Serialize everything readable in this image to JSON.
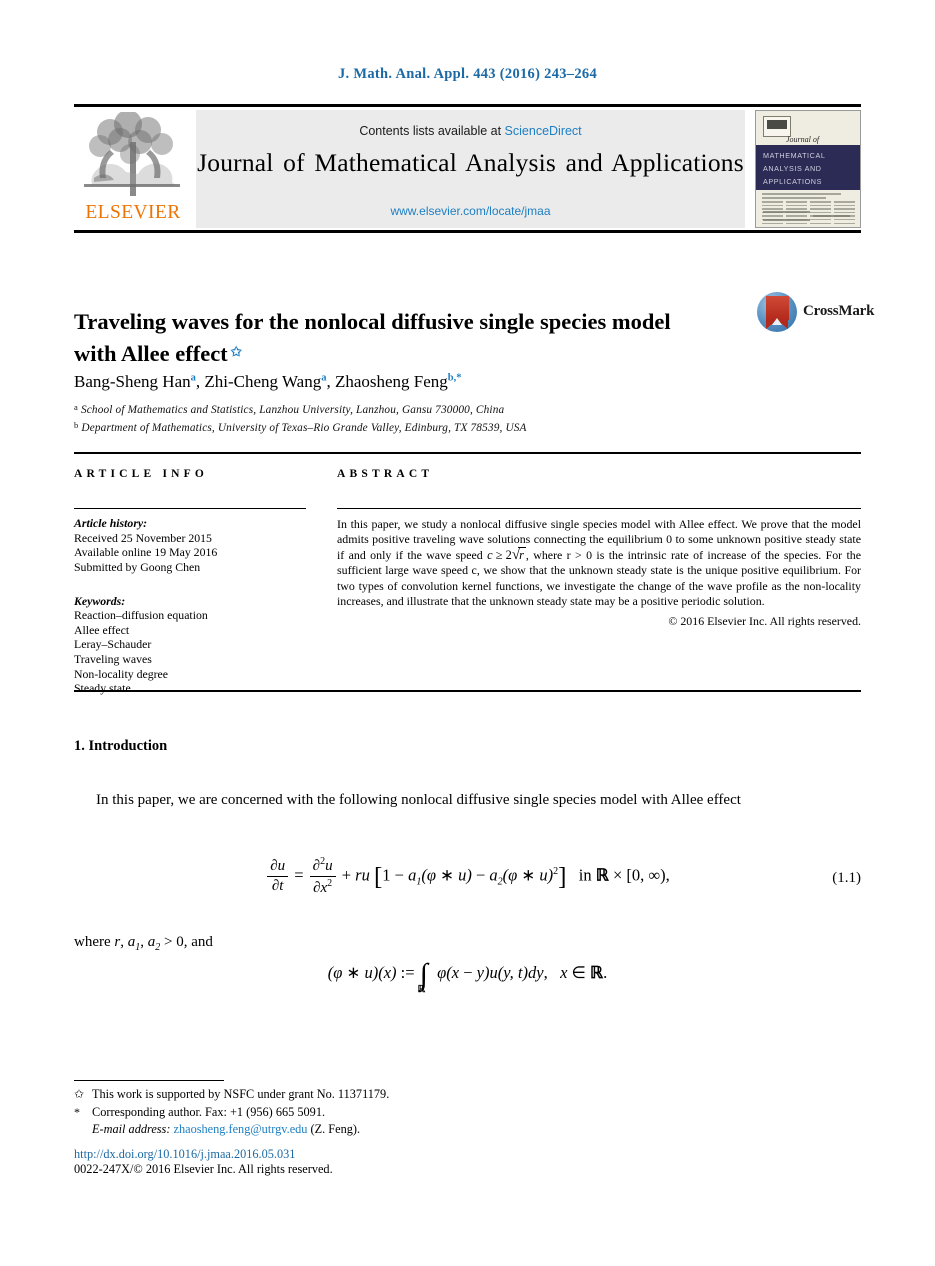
{
  "running_head": "J. Math. Anal. Appl. 443 (2016) 243–264",
  "masthead": {
    "contents_prefix": "Contents lists available at ",
    "sciencedirect": "ScienceDirect",
    "journal_title": "Journal of Mathematical Analysis and Applications",
    "journal_url": "www.elsevier.com/locate/jmaa",
    "publisher_wordmark": "ELSEVIER",
    "logo_icon": "elsevier-tree-icon",
    "cover": {
      "script_line": "Journal of",
      "band_title": "MATHEMATICAL ANALYSIS AND APPLICATIONS"
    },
    "accent_link_color": "#1d7fc3",
    "wordmark_color": "#ec7404"
  },
  "article": {
    "title": "Traveling waves for the nonlocal diffusive single species model with Allee effect",
    "title_footnote_marker": "✩",
    "crossmark": {
      "label": "CrossMark",
      "icon": "crossmark-icon"
    },
    "authors": [
      {
        "name": "Bang-Sheng Han",
        "marker": "a"
      },
      {
        "name": "Zhi-Cheng Wang",
        "marker": "a"
      },
      {
        "name": "Zhaosheng Feng",
        "marker": "b,*"
      }
    ],
    "affiliations": [
      {
        "marker": "a",
        "text": "School of Mathematics and Statistics, Lanzhou University, Lanzhou, Gansu 730000, China"
      },
      {
        "marker": "b",
        "text": "Department of Mathematics, University of Texas–Rio Grande Valley, Edinburg, TX 78539, USA"
      }
    ]
  },
  "info": {
    "heading": "ARTICLE INFO",
    "history_label": "Article history:",
    "history": [
      "Received 25 November 2015",
      "Available online 19 May 2016",
      "Submitted by Goong Chen"
    ],
    "keywords_label": "Keywords:",
    "keywords": [
      "Reaction–diffusion equation",
      "Allee effect",
      "Leray–Schauder",
      "Traveling waves",
      "Non-locality degree",
      "Steady state"
    ]
  },
  "abstract": {
    "heading": "ABSTRACT",
    "paragraph_part1": "In this paper, we study a nonlocal diffusive single species model with Allee effect. We prove that the model admits positive traveling wave solutions connecting the equilibrium 0 to some unknown positive steady state if and only if the wave speed ",
    "inline_math": "c ≥ 2√r",
    "paragraph_part2": ", where r > 0 is the intrinsic rate of increase of the species. For the sufficient large wave speed c, we show that the unknown steady state is the unique positive equilibrium. For two types of convolution kernel functions, we investigate the change of the wave profile as the non-locality increases, and illustrate that the unknown steady state may be a positive periodic solution.",
    "copyright": "© 2016 Elsevier Inc. All rights reserved."
  },
  "body": {
    "section_heading": "1. Introduction",
    "paragraph_1": "In this paper, we are concerned with the following nonlocal diffusive single species model with Allee effect",
    "equation_1": {
      "number": "(1.1)",
      "latex": "\\frac{\\partial u}{\\partial t} = \\frac{\\partial^2 u}{\\partial x^2} + ru\\left[1 - a_1(\\phi * u) - a_2(\\phi * u)^2\\right] \\quad \\text{in } \\mathbb{R}\\times[0,\\infty),"
    },
    "paragraph_2": "where r, a₁, a₂ > 0, and",
    "equation_2": {
      "latex": "(\\phi * u)(x) := \\int_{\\mathbb{R}} \\phi(x-y)u(y,t)dy, \\quad x \\in \\mathbb{R}."
    }
  },
  "footnotes": {
    "items": [
      {
        "marker": "✩",
        "text": "This work is supported by NSFC under grant No. 11371179."
      },
      {
        "marker": "*",
        "text": "Corresponding author. Fax: +1 (956) 665 5091."
      }
    ],
    "email_label": "E-mail address:",
    "email": "zhaosheng.feng@utrgv.edu",
    "email_suffix": "(Z. Feng)."
  },
  "footer": {
    "doi": "http://dx.doi.org/10.1016/j.jmaa.2016.05.031",
    "issn_line": "0022-247X/© 2016 Elsevier Inc. All rights reserved."
  }
}
